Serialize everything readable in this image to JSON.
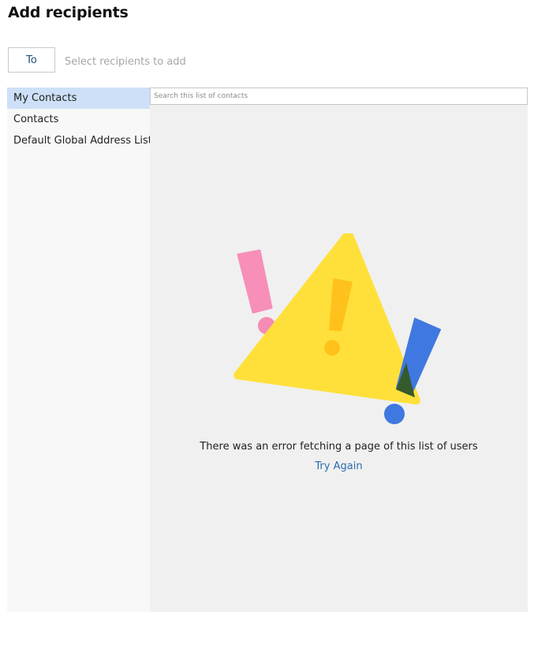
{
  "dialog": {
    "title": "Add recipients"
  },
  "recipients": {
    "to_label": "To",
    "placeholder": "Select recipients to add"
  },
  "sidebar": {
    "items": [
      {
        "label": "My Contacts",
        "selected": true
      },
      {
        "label": "Contacts",
        "selected": false
      },
      {
        "label": "Default Global Address List",
        "selected": false
      }
    ]
  },
  "search": {
    "placeholder": "Search this list of contacts"
  },
  "error": {
    "message": "There was an error fetching a page of this list of users",
    "retry_label": "Try Again",
    "illustration": "warning-triangle-icon",
    "colors": {
      "triangle": "#ffe03b",
      "pink": "#f78fb8",
      "blue": "#3f78e0",
      "amber": "#ffc21c"
    }
  }
}
